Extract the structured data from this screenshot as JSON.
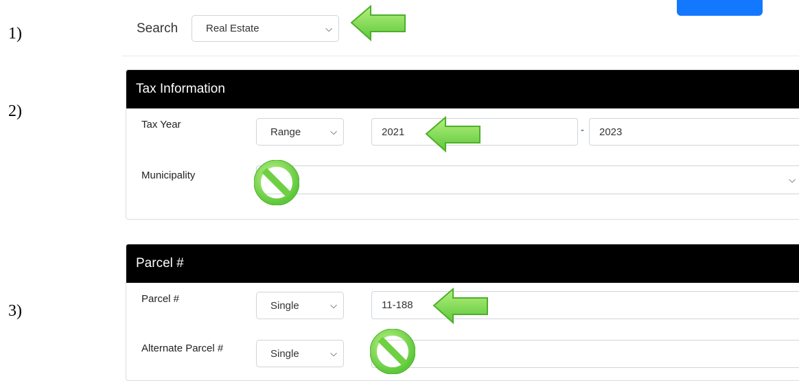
{
  "steps": [
    "1)",
    "2)",
    "3)"
  ],
  "search": {
    "label": "Search",
    "selected": "Real Estate"
  },
  "tax_panel": {
    "title": "Tax Information",
    "tax_year": {
      "label": "Tax Year",
      "mode": "Range",
      "from": "2021",
      "to": "2023",
      "separator": "-"
    },
    "municipality": {
      "label": "Municipality",
      "value": ""
    }
  },
  "parcel_panel": {
    "title": "Parcel #",
    "parcel": {
      "label": "Parcel #",
      "mode": "Single",
      "value": "11-188"
    },
    "alt_parcel": {
      "label": "Alternate Parcel #",
      "mode": "Single",
      "value": ""
    }
  },
  "colors": {
    "arrow": "#7fd855",
    "accent_button": "#1478ff",
    "panel_header": "#000000"
  }
}
